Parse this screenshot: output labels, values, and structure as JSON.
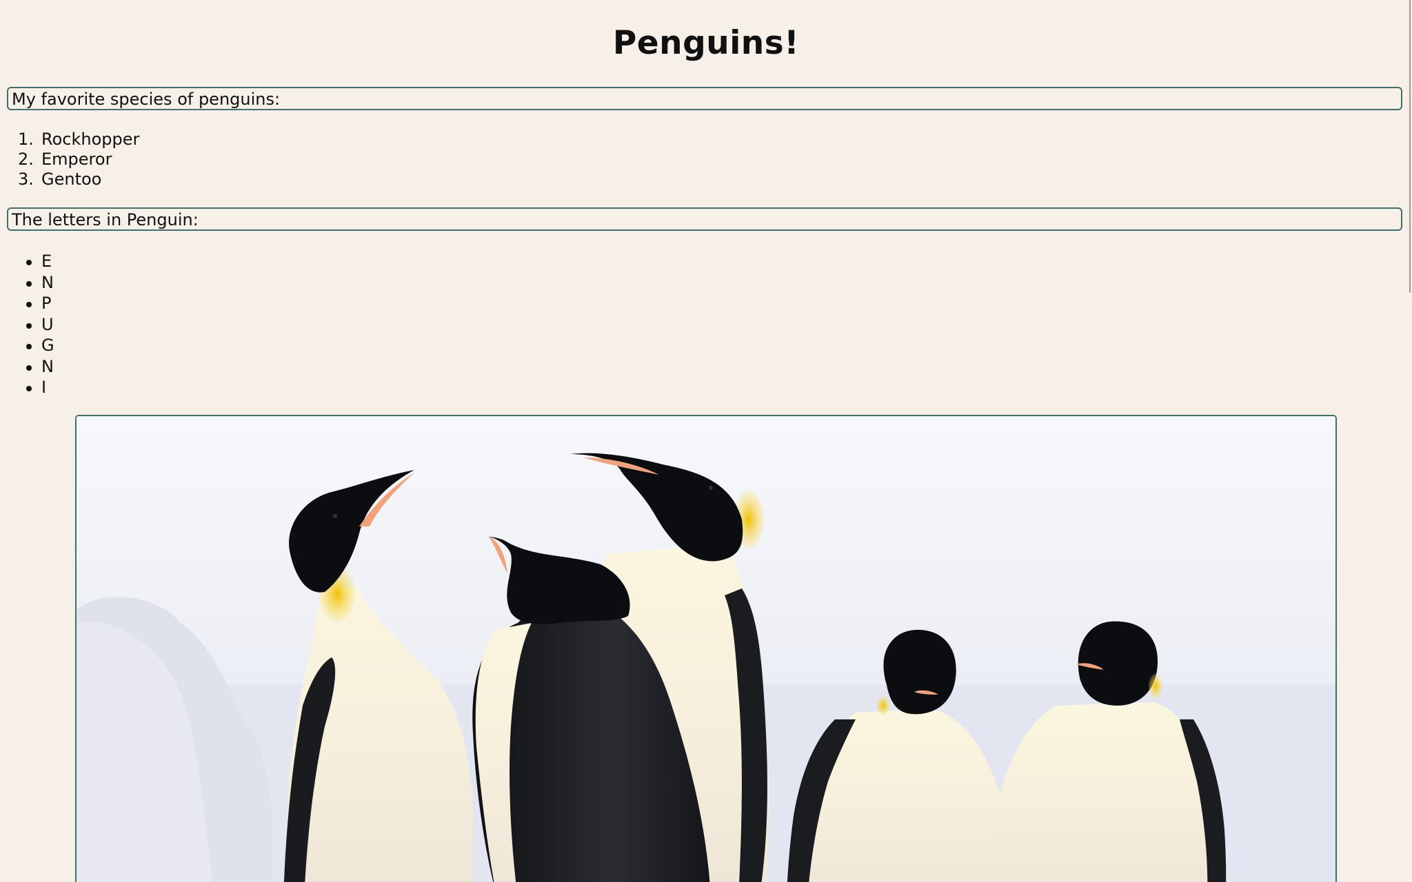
{
  "page": {
    "title": "Penguins!"
  },
  "species_section": {
    "heading": "My favorite species of penguins:",
    "items": [
      {
        "marker": "1.",
        "label": "Rockhopper"
      },
      {
        "marker": "2.",
        "label": "Emperor"
      },
      {
        "marker": "3.",
        "label": "Gentoo"
      }
    ]
  },
  "letters_section": {
    "heading": "The letters in Penguin:",
    "items": [
      "E",
      "N",
      "P",
      "U",
      "G",
      "N",
      "I"
    ]
  },
  "photo": {
    "subject": "group of five emperor penguins on ice"
  },
  "colors": {
    "background": "#f7f0e9",
    "border": "#3f6f6a",
    "text": "#111111"
  }
}
